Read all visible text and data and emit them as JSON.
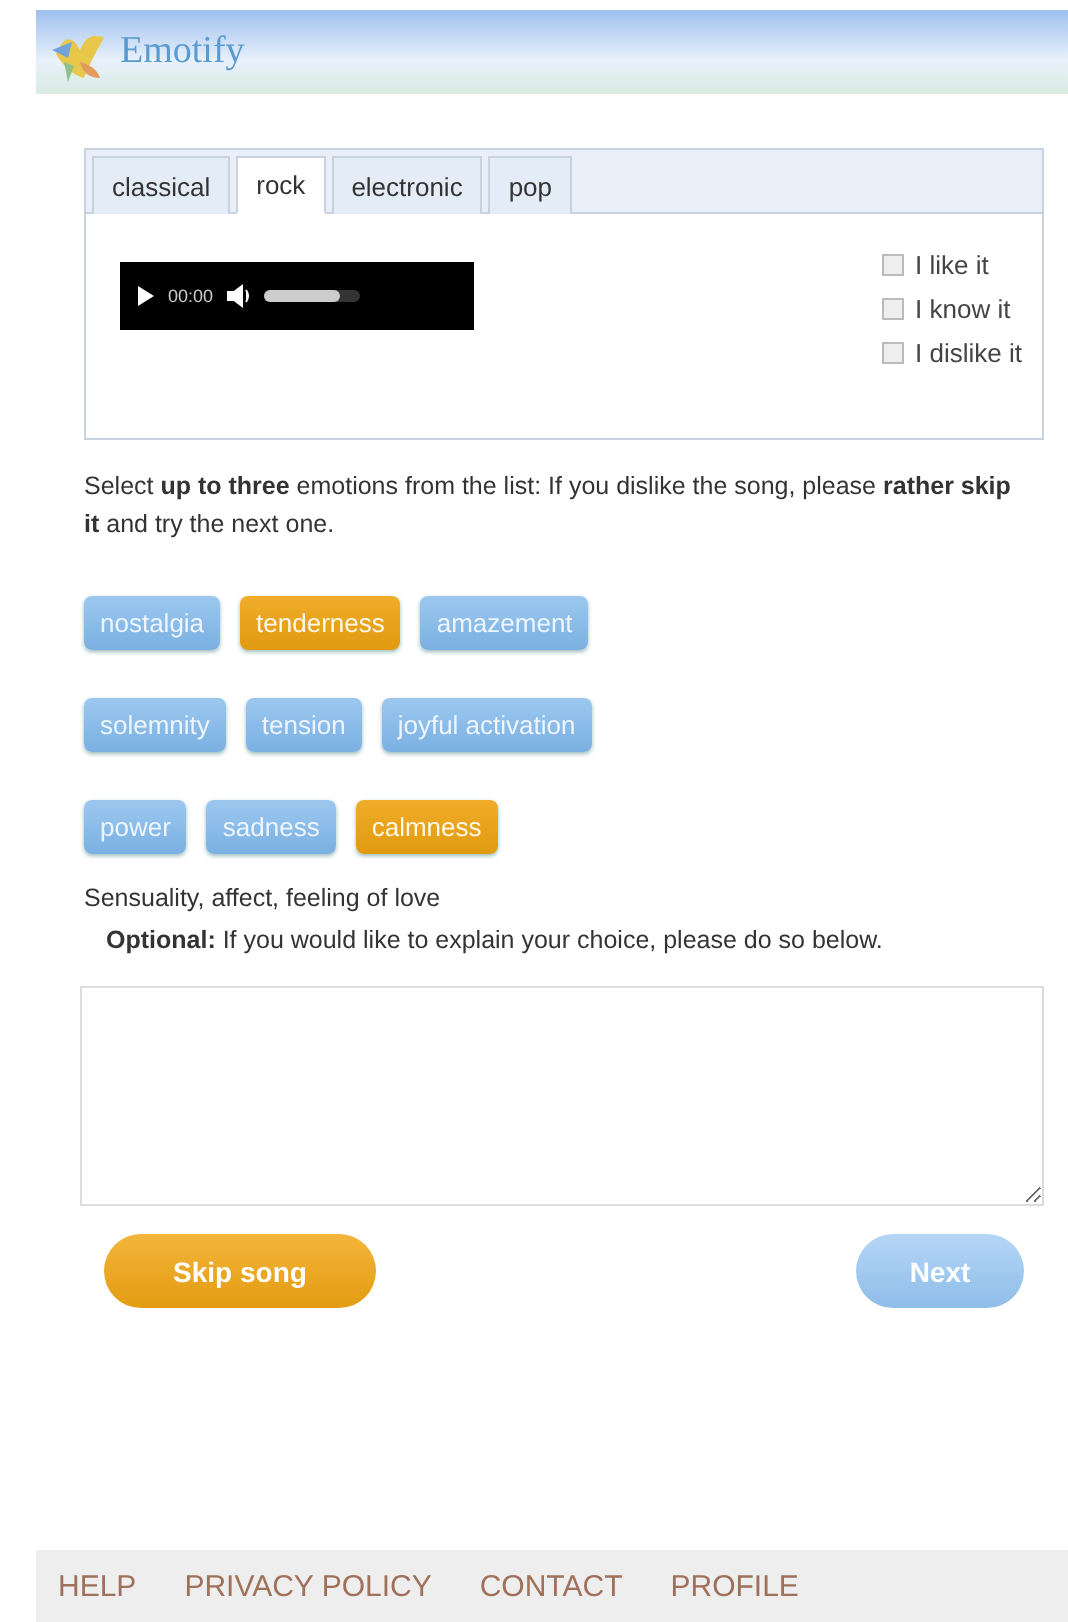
{
  "header": {
    "title": "Emotify"
  },
  "tabs": [
    {
      "label": "classical",
      "selected": false
    },
    {
      "label": "rock",
      "selected": true
    },
    {
      "label": "electronic",
      "selected": false
    },
    {
      "label": "pop",
      "selected": false
    }
  ],
  "player": {
    "time": "00:00",
    "volume": {
      "level": 0.8
    }
  },
  "ratings": [
    {
      "label": "I like it",
      "checked": false
    },
    {
      "label": "I know it",
      "checked": false
    },
    {
      "label": "I dislike it",
      "checked": false
    }
  ],
  "instructions": "Select **up to three** emotions from the list: If you dislike the song, please **rather skip it** and try the next one.",
  "emotion_rows": [
    [
      {
        "label": "nostalgia",
        "selected": false
      },
      {
        "label": "tenderness",
        "selected": true
      },
      {
        "label": "amazement",
        "selected": false
      }
    ],
    [
      {
        "label": "solemnity",
        "selected": false
      },
      {
        "label": "tension",
        "selected": false
      },
      {
        "label": "joyful activation",
        "selected": false
      }
    ],
    [
      {
        "label": "power",
        "selected": false
      },
      {
        "label": "sadness",
        "selected": false
      },
      {
        "label": "calmness",
        "selected": true
      }
    ]
  ],
  "description": "Sensuality, affect, feeling of love",
  "optional_note": "**Optional:** If you would like to explain your choice, please do so below.",
  "buttons": [
    {
      "label": "Skip song",
      "kind": "skip"
    },
    {
      "label": "Next",
      "kind": "next"
    }
  ],
  "footer_links": [
    "HELP",
    "PRIVACY POLICY",
    "CONTACT",
    "PROFILE"
  ]
}
